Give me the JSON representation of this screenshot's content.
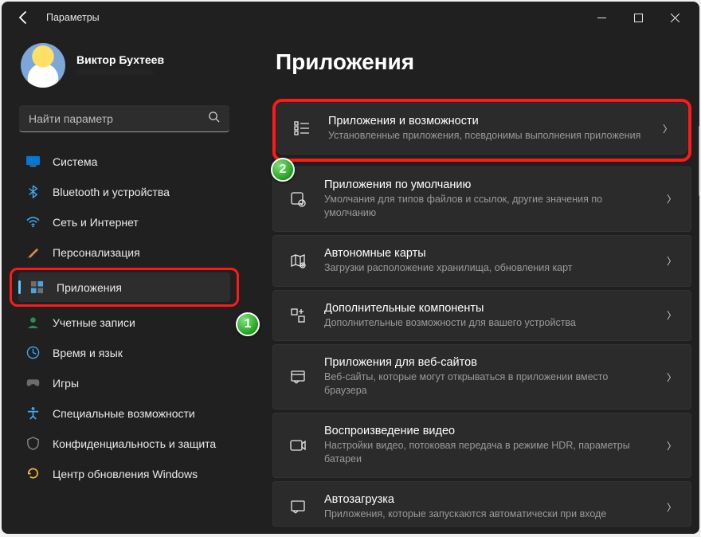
{
  "window": {
    "title": "Параметры"
  },
  "profile": {
    "name": "Виктор Бухтеев",
    "email": "························"
  },
  "search": {
    "placeholder": "Найти параметр"
  },
  "sidebar": {
    "items": [
      {
        "label": "Система"
      },
      {
        "label": "Bluetooth и устройства"
      },
      {
        "label": "Сеть и Интернет"
      },
      {
        "label": "Персонализация"
      },
      {
        "label": "Приложения"
      },
      {
        "label": "Учетные записи"
      },
      {
        "label": "Время и язык"
      },
      {
        "label": "Игры"
      },
      {
        "label": "Специальные возможности"
      },
      {
        "label": "Конфиденциальность и защита"
      },
      {
        "label": "Центр обновления Windows"
      }
    ]
  },
  "page": {
    "title": "Приложения"
  },
  "cards": [
    {
      "title": "Приложения и возможности",
      "sub": "Установленные приложения, псевдонимы выполнения приложения"
    },
    {
      "title": "Приложения по умолчанию",
      "sub": "Умолчания для типов файлов и ссылок, другие значения по умолчанию"
    },
    {
      "title": "Автономные карты",
      "sub": "Загрузки расположение хранилища, обновления карт"
    },
    {
      "title": "Дополнительные компоненты",
      "sub": "Дополнительные возможности для вашего устройства"
    },
    {
      "title": "Приложения для веб-сайтов",
      "sub": "Веб-сайты, которые могут открываться в приложении вместо браузера"
    },
    {
      "title": "Воспроизведение видео",
      "sub": "Настройки видео, потоковая передача в режиме HDR, параметры батареи"
    },
    {
      "title": "Автозагрузка",
      "sub": "Приложения, которые запускаются автоматически при входе"
    }
  ],
  "annotations": {
    "badge1": "1",
    "badge2": "2"
  }
}
